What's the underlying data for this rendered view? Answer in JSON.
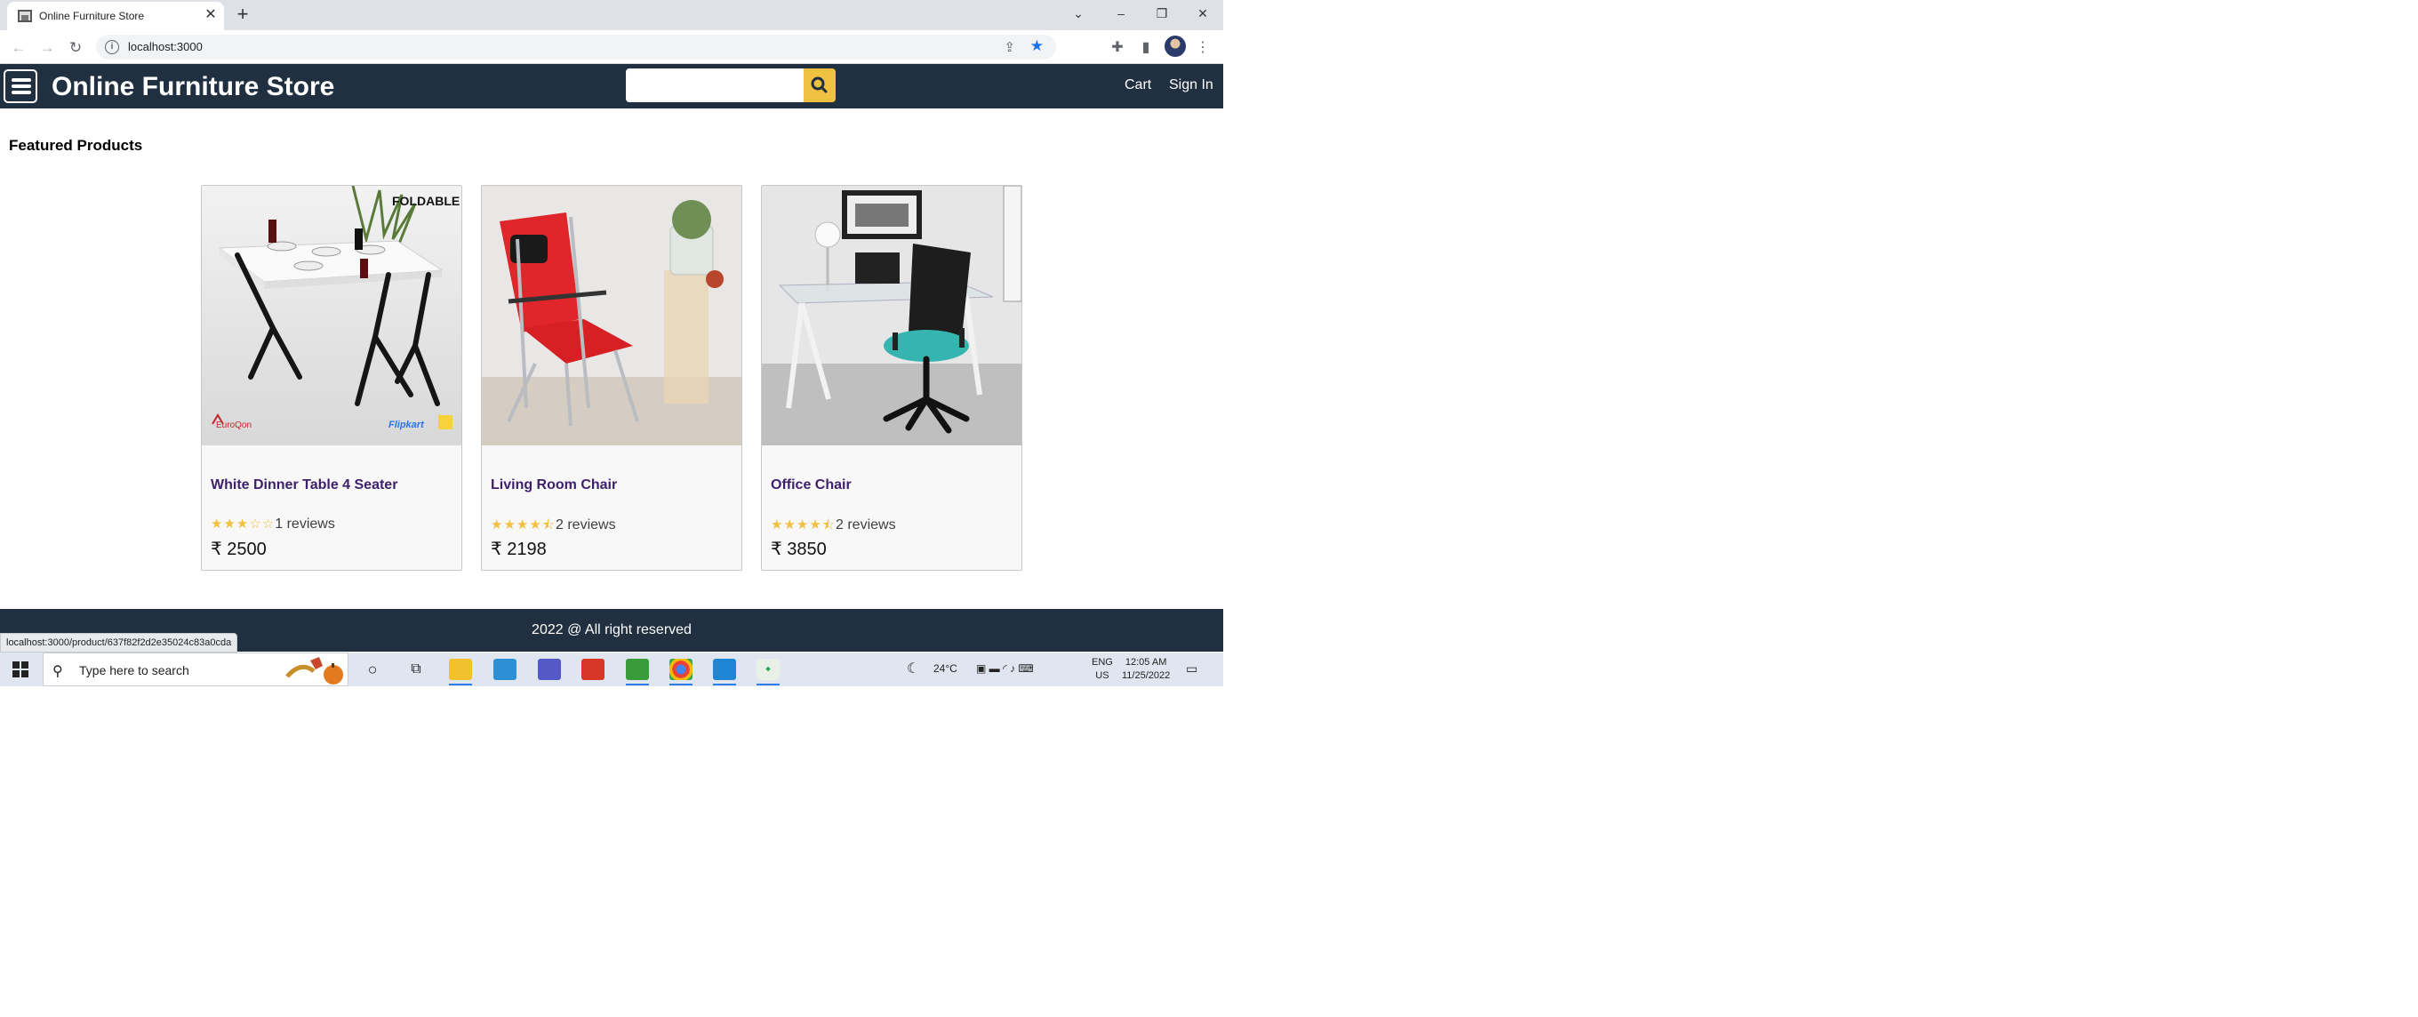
{
  "browser": {
    "tab_title": "Online Furniture Store",
    "url": "localhost:3000",
    "status_url": "localhost:3000/product/637f82f2d2e35024c83a0cda"
  },
  "site": {
    "brand": "Online Furniture Store",
    "search_placeholder": "",
    "nav_links": {
      "cart": "Cart",
      "signin": "Sign In"
    },
    "section_title": "Featured Products",
    "products": [
      {
        "name": "White Dinner Table 4 Seater",
        "rating": 3,
        "rating_stars": "★★★☆☆",
        "reviews_text": "1 reviews",
        "price": "₹ 2500",
        "image_labels": {
          "badge": "FOLDABLE",
          "brand": "EuroQon",
          "store": "Flipkart"
        }
      },
      {
        "name": "Living Room Chair",
        "rating": 4.5,
        "rating_stars": "★★★★⯪",
        "reviews_text": "2 reviews",
        "price": "₹ 2198"
      },
      {
        "name": "Office Chair",
        "rating": 4.5,
        "rating_stars": "★★★★⯪",
        "reviews_text": "2 reviews",
        "price": "₹ 3850"
      }
    ],
    "footer": "2022 @ All right reserved"
  },
  "taskbar": {
    "search_placeholder": "Type here to search",
    "weather": "24°C",
    "lang_top": "ENG",
    "lang_bottom": "US",
    "time": "12:05 AM",
    "date": "11/25/2022"
  },
  "colors": {
    "nav_bg": "#203040",
    "accent": "#f0c040",
    "product_name": "#3d1f6b"
  }
}
